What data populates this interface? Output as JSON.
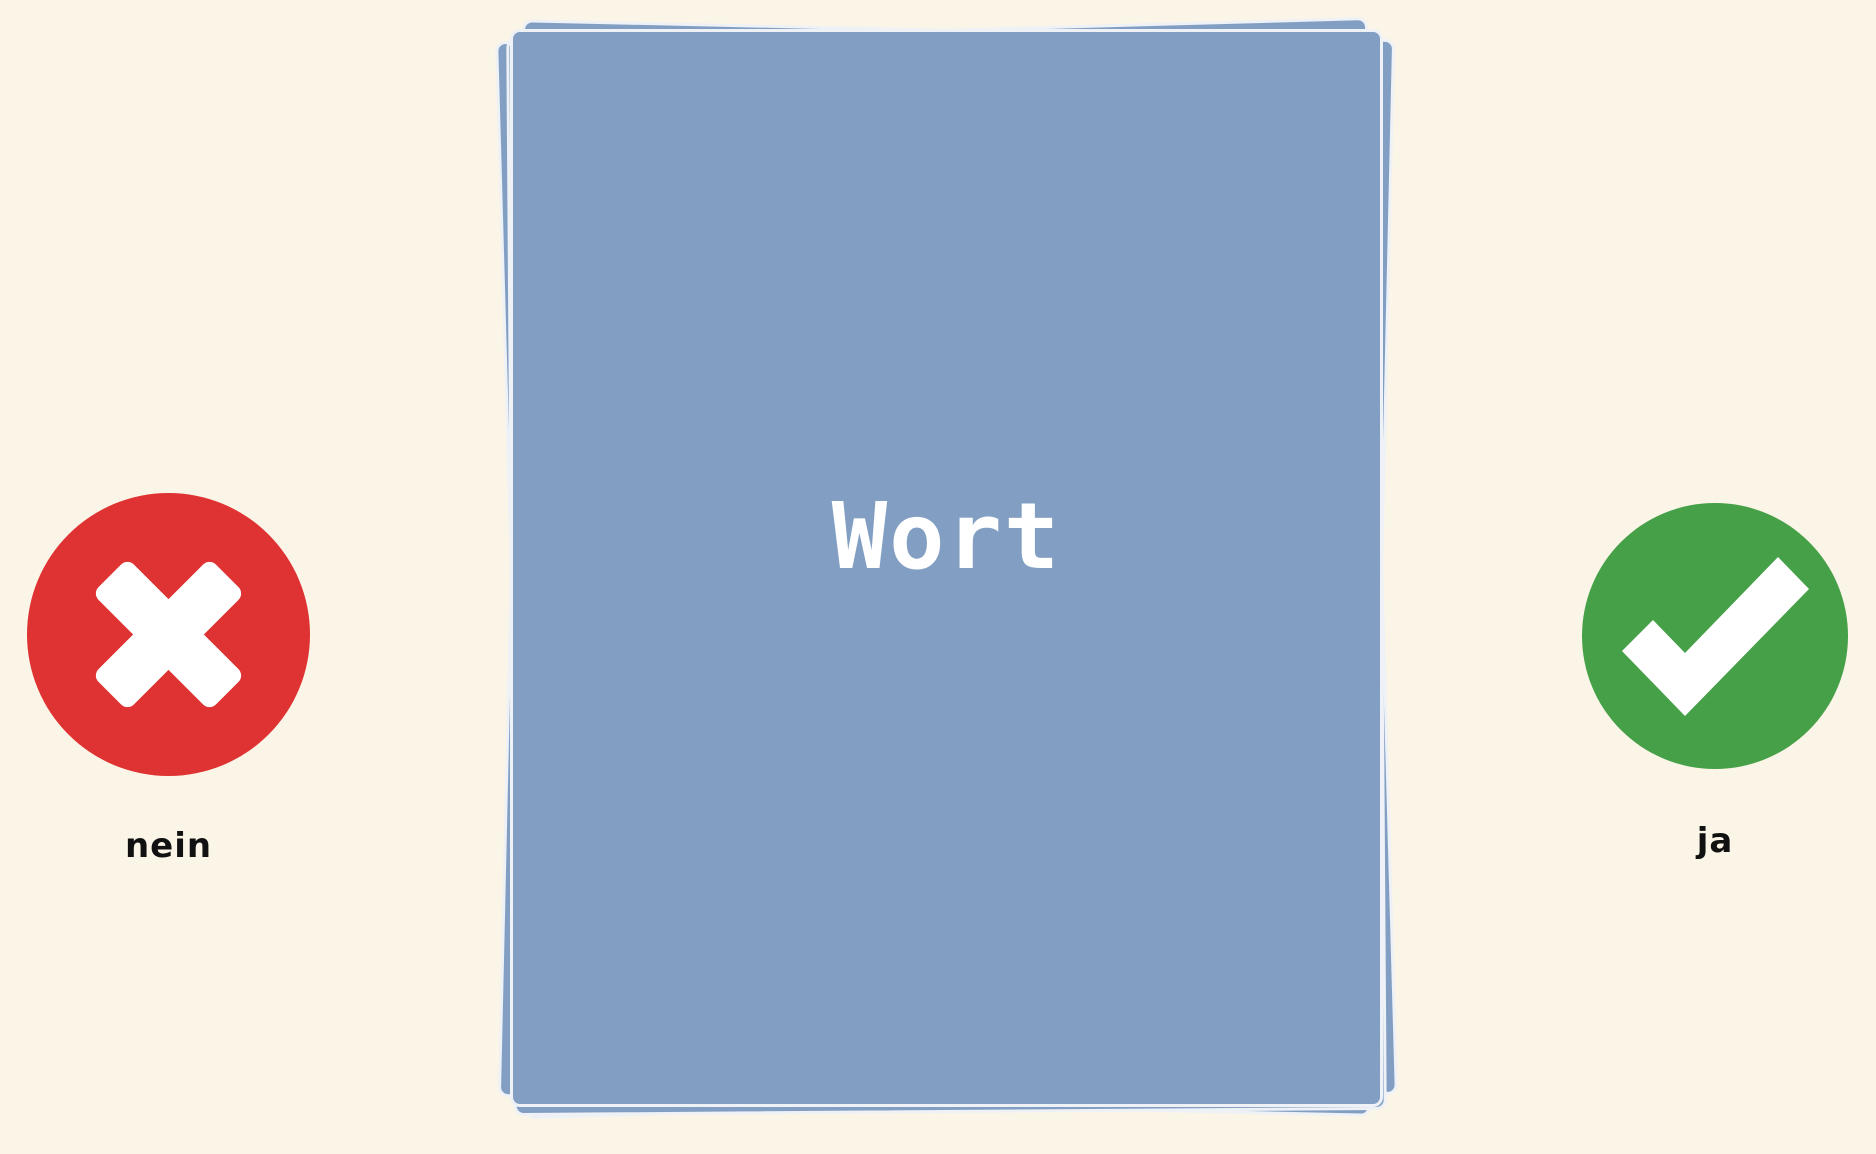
{
  "card": {
    "word": "Wort"
  },
  "answers": {
    "no": {
      "label": "nein",
      "icon": "cross-icon",
      "color": "#df3333"
    },
    "yes": {
      "label": "ja",
      "icon": "checkmark-icon",
      "color": "#45a048"
    }
  },
  "colors": {
    "background": "#fbf5e8",
    "card": "#829fc3",
    "card_border": "#eef1f6"
  }
}
